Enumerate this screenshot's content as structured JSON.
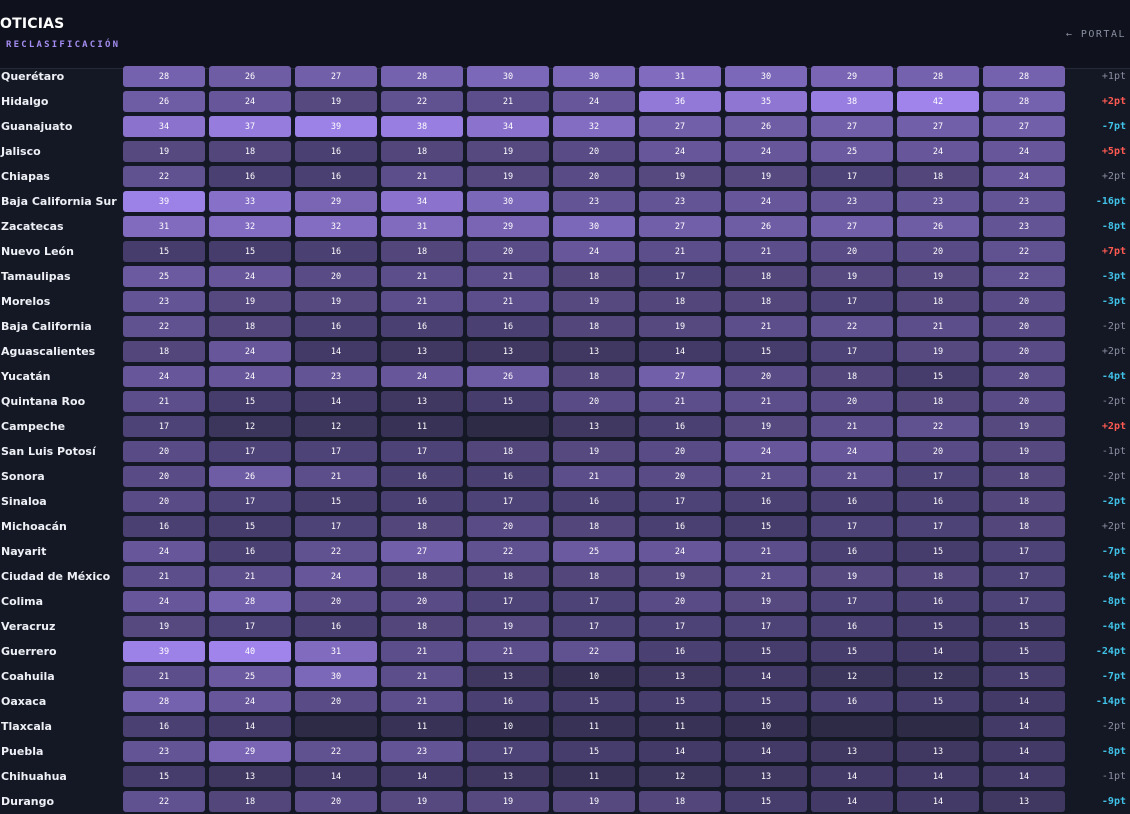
{
  "header": {
    "title": "OTICIAS",
    "subtitle": "RECLASIFICACIÓN",
    "portal_label": "← PORTAL"
  },
  "colors": {
    "background": "#141824",
    "header_bg": "#0f121c",
    "accent": "#a48cf0",
    "delta_positive": "#ff5a52",
    "delta_negative": "#40c2e8",
    "delta_neutral": "#8a8fa2"
  },
  "table": {
    "rows": [
      {
        "state": "Querétaro",
        "values": [
          28,
          26,
          27,
          28,
          30,
          30,
          31,
          30,
          29,
          28,
          28
        ],
        "delta": "+1pt",
        "trend": "neutral"
      },
      {
        "state": "Hidalgo",
        "values": [
          26,
          24,
          19,
          22,
          21,
          24,
          36,
          35,
          38,
          42,
          28
        ],
        "delta": "+2pt",
        "trend": "up"
      },
      {
        "state": "Guanajuato",
        "values": [
          34,
          37,
          39,
          38,
          34,
          32,
          27,
          26,
          27,
          27,
          27
        ],
        "delta": "-7pt",
        "trend": "down"
      },
      {
        "state": "Jalisco",
        "values": [
          19,
          18,
          16,
          18,
          19,
          20,
          24,
          24,
          25,
          24,
          24
        ],
        "delta": "+5pt",
        "trend": "up"
      },
      {
        "state": "Chiapas",
        "values": [
          22,
          16,
          16,
          21,
          19,
          20,
          19,
          19,
          17,
          18,
          24
        ],
        "delta": "+2pt",
        "trend": "neutral"
      },
      {
        "state": "Baja California Sur",
        "values": [
          39,
          33,
          29,
          34,
          30,
          23,
          23,
          24,
          23,
          23,
          23
        ],
        "delta": "-16pt",
        "trend": "down"
      },
      {
        "state": "Zacatecas",
        "values": [
          31,
          32,
          32,
          31,
          29,
          30,
          27,
          26,
          27,
          26,
          23
        ],
        "delta": "-8pt",
        "trend": "down"
      },
      {
        "state": "Nuevo León",
        "values": [
          15,
          15,
          16,
          18,
          20,
          24,
          21,
          21,
          20,
          20,
          22
        ],
        "delta": "+7pt",
        "trend": "up"
      },
      {
        "state": "Tamaulipas",
        "values": [
          25,
          24,
          20,
          21,
          21,
          18,
          17,
          18,
          19,
          19,
          22
        ],
        "delta": "-3pt",
        "trend": "down"
      },
      {
        "state": "Morelos",
        "values": [
          23,
          19,
          19,
          21,
          21,
          19,
          18,
          18,
          17,
          18,
          20
        ],
        "delta": "-3pt",
        "trend": "down"
      },
      {
        "state": "Baja California",
        "values": [
          22,
          18,
          16,
          16,
          16,
          18,
          19,
          21,
          22,
          21,
          20
        ],
        "delta": "-2pt",
        "trend": "neutral"
      },
      {
        "state": "Aguascalientes",
        "values": [
          18,
          24,
          14,
          13,
          13,
          13,
          14,
          15,
          17,
          19,
          20
        ],
        "delta": "+2pt",
        "trend": "neutral"
      },
      {
        "state": "Yucatán",
        "values": [
          24,
          24,
          23,
          24,
          26,
          18,
          27,
          20,
          18,
          15,
          20
        ],
        "delta": "-4pt",
        "trend": "down"
      },
      {
        "state": "Quintana Roo",
        "values": [
          21,
          15,
          14,
          13,
          15,
          20,
          21,
          21,
          20,
          18,
          20
        ],
        "delta": "-2pt",
        "trend": "neutral"
      },
      {
        "state": "Campeche",
        "values": [
          17,
          12,
          12,
          11,
          null,
          13,
          16,
          19,
          21,
          22,
          19
        ],
        "delta": "+2pt",
        "trend": "up"
      },
      {
        "state": "San Luis Potosí",
        "values": [
          20,
          17,
          17,
          17,
          18,
          19,
          20,
          24,
          24,
          20,
          19
        ],
        "delta": "-1pt",
        "trend": "neutral"
      },
      {
        "state": "Sonora",
        "values": [
          20,
          26,
          21,
          16,
          16,
          21,
          20,
          21,
          21,
          17,
          18
        ],
        "delta": "-2pt",
        "trend": "neutral"
      },
      {
        "state": "Sinaloa",
        "values": [
          20,
          17,
          15,
          16,
          17,
          16,
          17,
          16,
          16,
          16,
          18
        ],
        "delta": "-2pt",
        "trend": "down"
      },
      {
        "state": "Michoacán",
        "values": [
          16,
          15,
          17,
          18,
          20,
          18,
          16,
          15,
          17,
          17,
          18
        ],
        "delta": "+2pt",
        "trend": "neutral"
      },
      {
        "state": "Nayarit",
        "values": [
          24,
          16,
          22,
          27,
          22,
          25,
          24,
          21,
          16,
          15,
          17
        ],
        "delta": "-7pt",
        "trend": "down"
      },
      {
        "state": "Ciudad de México",
        "values": [
          21,
          21,
          24,
          18,
          18,
          18,
          19,
          21,
          19,
          18,
          17
        ],
        "delta": "-4pt",
        "trend": "down"
      },
      {
        "state": "Colima",
        "values": [
          24,
          28,
          20,
          20,
          17,
          17,
          20,
          19,
          17,
          16,
          17
        ],
        "delta": "-8pt",
        "trend": "down"
      },
      {
        "state": "Veracruz",
        "values": [
          19,
          17,
          16,
          18,
          19,
          17,
          17,
          17,
          16,
          15,
          15
        ],
        "delta": "-4pt",
        "trend": "down"
      },
      {
        "state": "Guerrero",
        "values": [
          39,
          40,
          31,
          21,
          21,
          22,
          16,
          15,
          15,
          14,
          15
        ],
        "delta": "-24pt",
        "trend": "down"
      },
      {
        "state": "Coahuila",
        "values": [
          21,
          25,
          30,
          21,
          13,
          10,
          13,
          14,
          12,
          12,
          15
        ],
        "delta": "-7pt",
        "trend": "down"
      },
      {
        "state": "Oaxaca",
        "values": [
          28,
          24,
          20,
          21,
          16,
          15,
          15,
          15,
          16,
          15,
          14
        ],
        "delta": "-14pt",
        "trend": "down"
      },
      {
        "state": "Tlaxcala",
        "values": [
          16,
          14,
          null,
          11,
          10,
          11,
          11,
          10,
          null,
          null,
          14
        ],
        "delta": "-2pt",
        "trend": "neutral"
      },
      {
        "state": "Puebla",
        "values": [
          23,
          29,
          22,
          23,
          17,
          15,
          14,
          14,
          13,
          13,
          14
        ],
        "delta": "-8pt",
        "trend": "down"
      },
      {
        "state": "Chihuahua",
        "values": [
          15,
          13,
          14,
          14,
          13,
          11,
          12,
          13,
          14,
          14,
          14
        ],
        "delta": "-1pt",
        "trend": "neutral"
      },
      {
        "state": "Durango",
        "values": [
          22,
          18,
          20,
          19,
          19,
          19,
          18,
          15,
          14,
          14,
          13
        ],
        "delta": "-9pt",
        "trend": "down"
      }
    ]
  }
}
